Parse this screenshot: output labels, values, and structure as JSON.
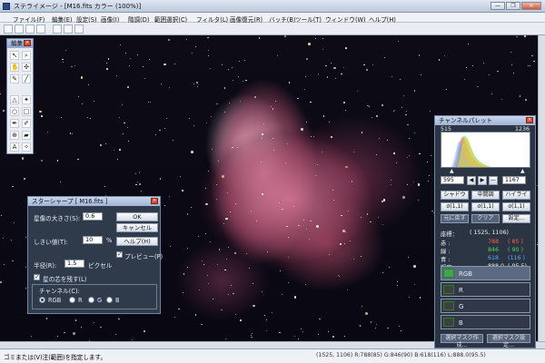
{
  "window": {
    "title": "ステライメージ - [M16.fits カラー (100%)]",
    "controls": [
      "—",
      "❐",
      "✕"
    ]
  },
  "menu": [
    "ファイル(F)",
    "編集(E)",
    "設定(S)",
    "画像(I)",
    "階調(D)",
    "範囲選択(C)",
    "フィルタ(L)",
    "画像復元(R)",
    "バッチ(B)",
    "ツール(T)",
    "ウィンドウ(W)",
    "ヘルプ(H)"
  ],
  "tool_palette": {
    "title": "編集",
    "tools": [
      "hand-tool-icon",
      "zoom-tool-icon",
      "select-tool-icon",
      "star-tool-icon",
      "brush-tool-icon",
      "text-tool-icon"
    ]
  },
  "star_sharp": {
    "title": "スターシャープ [ M16.fits ]",
    "star_size_label": "星像の大きさ(S):",
    "star_size_value": "0.6",
    "threshold_label": "しきい値(T):",
    "threshold_value": "10",
    "threshold_unit": "%",
    "radius_label": "半径(R):",
    "radius_value": "1.5",
    "radius_unit": "ピクセル",
    "ok_label": "OK",
    "cancel_label": "キャンセル",
    "help_label": "ヘルプ(H)",
    "preview_label": "プレビュー(P)",
    "keep_core_label": "星の芯を残す(L)",
    "channel_label": "チャンネル(C):",
    "channels": [
      "RGB",
      "R",
      "G",
      "B"
    ],
    "preview_checked": true,
    "keep_core_checked": true
  },
  "channel_palette": {
    "title": "チャンネルパレット",
    "hist_min": "515",
    "hist_max": "1236",
    "range_low": "595",
    "range_high": "1167",
    "buttons_row1": [
      "シャドウ",
      "中間調",
      "ハイライト"
    ],
    "buttons_row2": [
      "σ(1,1)",
      "σ(1,1)",
      "σ(1,1)"
    ],
    "buttons_row3": [
      "元に戻す",
      "クリア",
      "設定..."
    ],
    "coord_label": "座標：",
    "coord_value": "( 1525,  1106)",
    "rows": [
      {
        "label": "赤 :",
        "value": "788",
        "sub": "( 85 )",
        "color": "#ff5a4a"
      },
      {
        "label": "緑 :",
        "value": "846",
        "sub": "( 90 )",
        "color": "#59d65a"
      },
      {
        "label": "青 :",
        "value": "618",
        "sub": "(116 )",
        "color": "#57a8ff"
      },
      {
        "label": "輝度 :",
        "value": "888.0",
        "sub": "( 95.5)",
        "color": "#eaeef4"
      }
    ],
    "channels": [
      "RGB",
      "R",
      "G",
      "B"
    ],
    "bottom_buttons": [
      "選択マスク作成...",
      "選択マスク設定..."
    ]
  },
  "status": {
    "left": "ゴミまたは(V)注(範囲)を指定します。",
    "right": "(1525, 1106) R:788(85) G:846(90) B:618(116) L:888.0(95.5)"
  }
}
